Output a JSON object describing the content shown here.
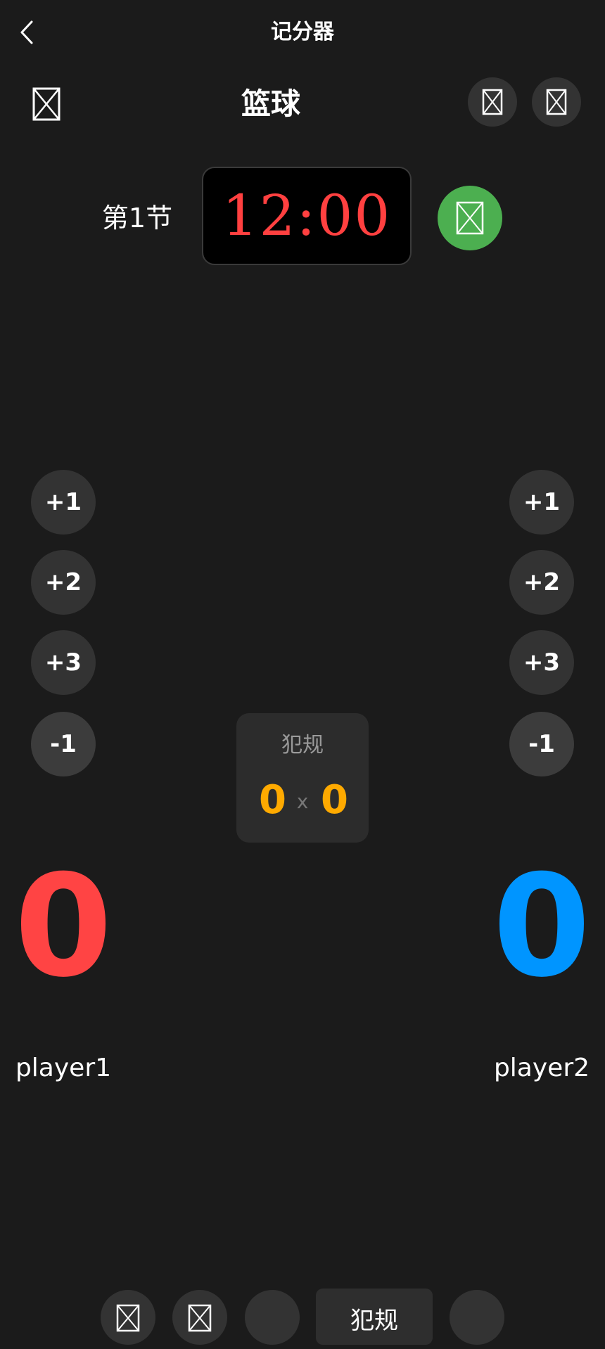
{
  "nav": {
    "title": "记分器",
    "back_icon": "chevron-left-icon"
  },
  "header": {
    "sport": "篮球",
    "left_tool_icon": "broken-image-icon",
    "right_tool_icons": [
      "broken-image-icon",
      "broken-image-icon"
    ]
  },
  "timer": {
    "period": "第1节",
    "time": "12:00",
    "play_icon": "broken-image-icon"
  },
  "team1": {
    "buttons": [
      "+1",
      "+2",
      "+3",
      "-1"
    ],
    "score": "0",
    "name": "player1",
    "color": "#ff4444"
  },
  "team2": {
    "buttons": [
      "+1",
      "+2",
      "+3",
      "-1"
    ],
    "score": "0",
    "name": "player2",
    "color": "#0095ff"
  },
  "fouls": {
    "label": "犯规",
    "left": "0",
    "separator": "x",
    "right": "0",
    "color": "#ffaa00"
  },
  "bottom_bar": {
    "tab_label": "犯规",
    "icons": [
      "broken-image-icon",
      "broken-image-icon"
    ]
  },
  "colors": {
    "background": "#1b1b1b",
    "accent_green": "#4caf50",
    "timer_red": "#ff4040"
  }
}
